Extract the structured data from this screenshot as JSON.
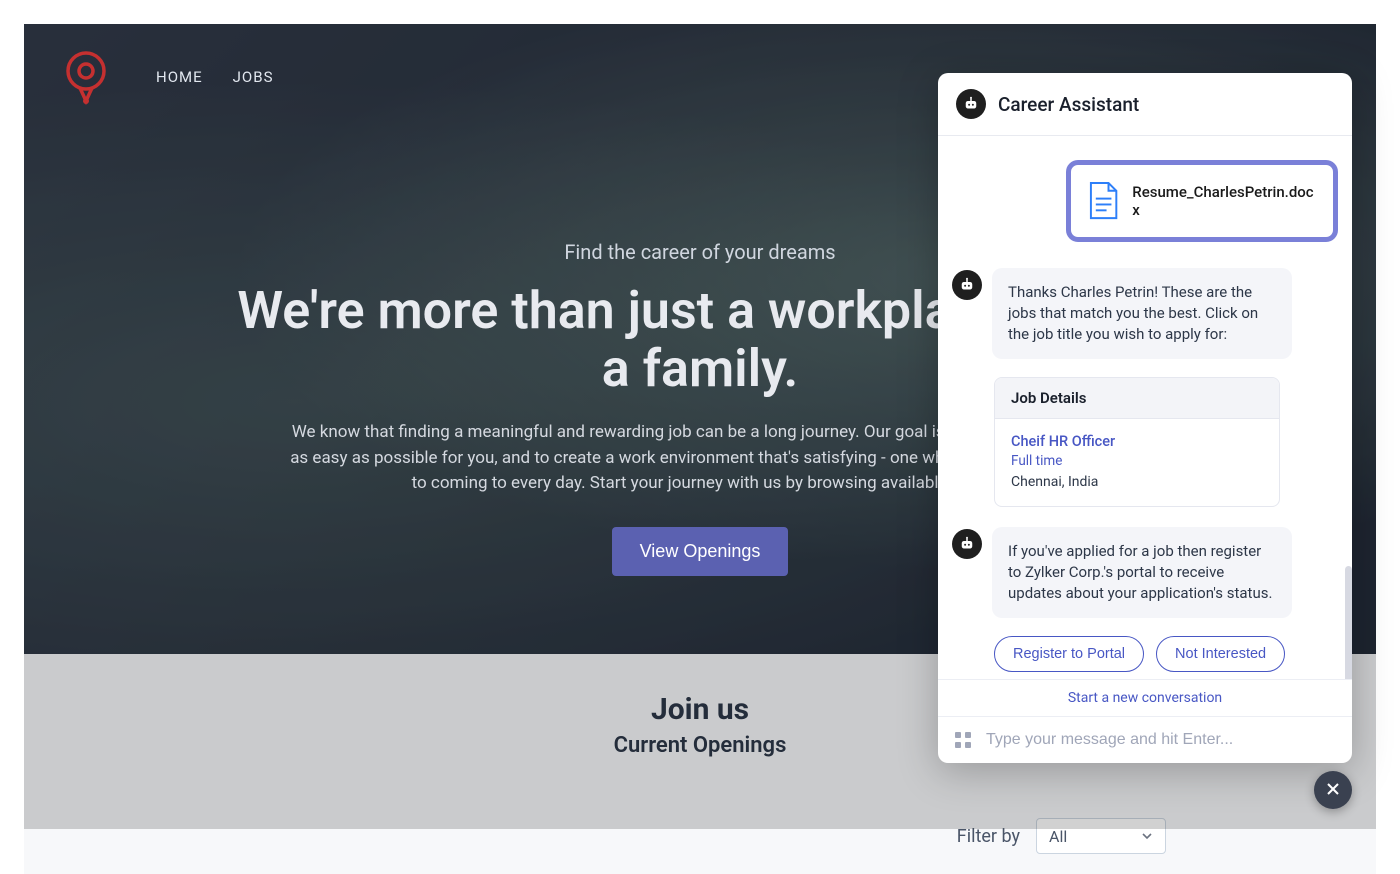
{
  "nav": {
    "home": "HOME",
    "jobs": "JOBS"
  },
  "hero": {
    "tagline": "Find the career of your dreams",
    "title": "We're more than just a workplace. We're a family.",
    "description": "We know that finding a meaningful and rewarding job can be a long journey. Our goal is to make that process as easy as possible for you, and to create a work environment that's satisfying - one where you'll look forward to coming to every day. Start your journey with us by browsing available jobs.",
    "button": "View Openings"
  },
  "section": {
    "heading": "Join us",
    "subheading": "Current Openings",
    "filter_label": "Filter by",
    "filter_value": "All"
  },
  "chat": {
    "title": "Career Assistant",
    "file_name": "Resume_CharlesPetrin.docx",
    "msg1": "Thanks Charles Petrin! These are the jobs that match you the best. Click on the job title you wish to apply for:",
    "job_details_header": "Job Details",
    "job_title": "Cheif HR Officer",
    "job_type": "Full time",
    "job_location": "Chennai, India",
    "msg2": "If you've applied for a job then register to Zylker Corp.'s portal to receive updates about your application's status.",
    "btn_register": "Register to Portal",
    "btn_notinterested": "Not Interested",
    "new_conv": "Start a new conversation",
    "input_placeholder": "Type your message and hit Enter..."
  }
}
